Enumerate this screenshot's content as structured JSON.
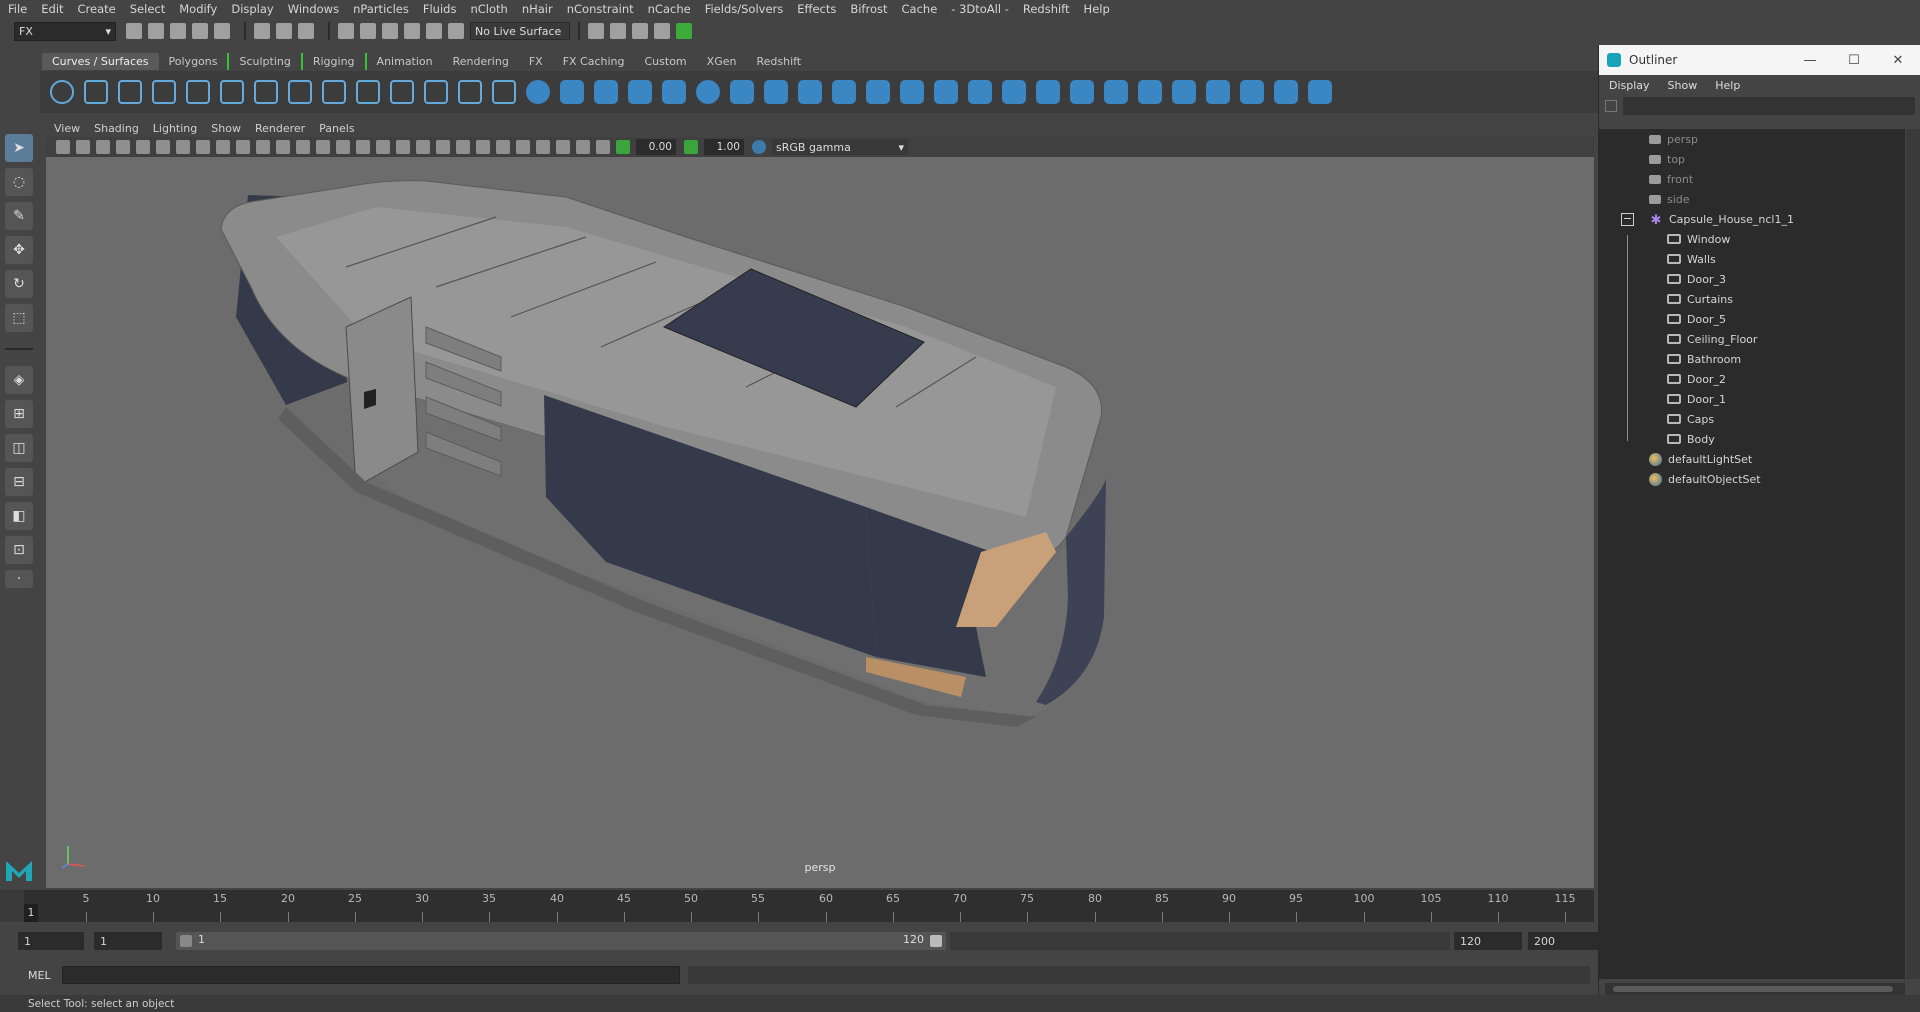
{
  "menubar": [
    "File",
    "Edit",
    "Create",
    "Select",
    "Modify",
    "Display",
    "Windows",
    "nParticles",
    "Fluids",
    "nCloth",
    "nHair",
    "nConstraint",
    "nCache",
    "Fields/Solvers",
    "Effects",
    "Bifrost",
    "Cache",
    "- 3DtoAll -",
    "Redshift",
    "Help"
  ],
  "statusline": {
    "mode": "FX",
    "live_surface": "No Live Surface"
  },
  "shelf_tabs": [
    "Curves / Surfaces",
    "Polygons",
    "Sculpting",
    "Rigging",
    "Animation",
    "Rendering",
    "FX",
    "FX Caching",
    "Custom",
    "XGen",
    "Redshift"
  ],
  "panel_menu": [
    "View",
    "Shading",
    "Lighting",
    "Show",
    "Renderer",
    "Panels"
  ],
  "panel_toolbar": {
    "exposure": "0.00",
    "gamma": "1.00",
    "color_space": "sRGB gamma"
  },
  "viewport": {
    "camera_label": "persp"
  },
  "timeline": {
    "ticks": [
      "5",
      "10",
      "15",
      "20",
      "25",
      "30",
      "35",
      "40",
      "45",
      "50",
      "55",
      "60",
      "65",
      "70",
      "75",
      "80",
      "85",
      "90",
      "95",
      "100",
      "105",
      "110",
      "115"
    ],
    "current_frame": "1"
  },
  "range": {
    "start": "1",
    "playback_start": "1",
    "bar_start": "1",
    "bar_end": "120",
    "playback_end": "120",
    "end": "200"
  },
  "cmdline": {
    "label": "MEL"
  },
  "helpline": "Select Tool: select an object",
  "outliner": {
    "title": "Outliner",
    "menu": [
      "Display",
      "Show",
      "Help"
    ],
    "cameras": [
      "persp",
      "top",
      "front",
      "side"
    ],
    "group": "Capsule_House_ncl1_1",
    "children": [
      "Window",
      "Walls",
      "Door_3",
      "Curtains",
      "Door_5",
      "Ceiling_Floor",
      "Bathroom",
      "Door_2",
      "Door_1",
      "Caps",
      "Body"
    ],
    "sets": [
      "defaultLightSet",
      "defaultObjectSet"
    ]
  }
}
